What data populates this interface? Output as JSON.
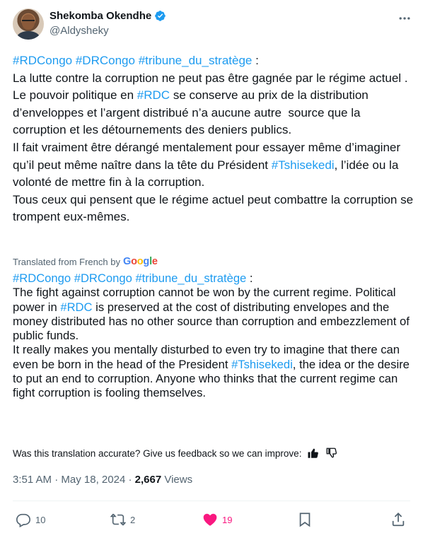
{
  "author": {
    "name": "Shekomba Okendhe",
    "handle": "@Aldysheky"
  },
  "tweet": {
    "original": {
      "tags_line": [
        "#RDCongo",
        "#DRCongo",
        "#tribune_du_stratège"
      ],
      "colon": " :",
      "p1a": "La lutte contre la corruption ne peut pas être gagnée par le régime actuel . Le pouvoir politique en ",
      "p1_tag": "#RDC",
      "p1b": " se conserve au prix de la distribution d’enveloppes et l’argent distribué n’a aucune autre  source que la corruption et les détournements des deniers publics.",
      "p2a": "Il fait vraiment être dérangé mentalement pour essayer même d’imaginer qu’il peut même naître dans la tête du Président ",
      "p2_tag": "#Tshisekedi",
      "p2b": ", l’idée ou la volonté de mettre fin à la corruption.",
      "p3": "Tous ceux qui pensent que le régime actuel peut combattre la corruption se trompent eux-mêmes."
    },
    "translated_by": "Translated from French by",
    "google": [
      "G",
      "o",
      "o",
      "g",
      "l",
      "e"
    ],
    "translation": {
      "tags_line": [
        "#RDCongo",
        "#DRCongo",
        "#tribune_du_stratège"
      ],
      "colon": " :",
      "p1a": "The fight against corruption cannot be won by the current regime. Political power in ",
      "p1_tag": "#RDC",
      "p1b": " is preserved at the cost of distributing envelopes and the money distributed has no other source than corruption and embezzlement of public funds.",
      "p2a": "It really makes you mentally disturbed to even try to imagine that there can even be born in the head of the President ",
      "p2_tag": "#Tshisekedi",
      "p2b": ", the idea or the desire to put an end to corruption. Anyone who thinks that the current regime can fight corruption is fooling themselves."
    },
    "feedback_prompt": "Was this translation accurate? Give us feedback so we can improve:",
    "time": "3:51 AM",
    "sep": " · ",
    "date": "May 18, 2024",
    "views_count": "2,667",
    "views_label": " Views"
  },
  "actions": {
    "replies": "10",
    "reposts": "2",
    "likes": "19"
  },
  "colors": {
    "accent": "#1d9bf0",
    "like": "#f91880",
    "muted": "#536471"
  }
}
